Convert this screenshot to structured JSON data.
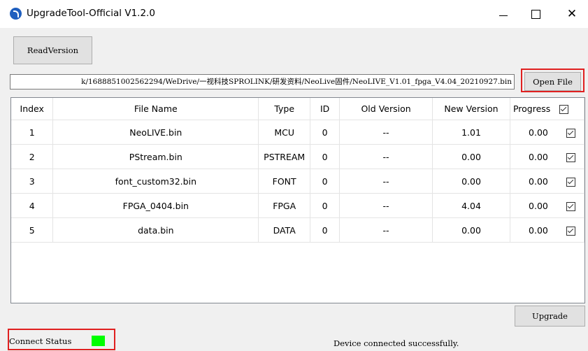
{
  "window": {
    "title": "UpgradeTool-Official V1.2.0",
    "minimize_glyph": "—",
    "maximize_glyph": "☐",
    "close_glyph": "✕"
  },
  "toolbar": {
    "read_version_label": "ReadVersion",
    "open_file_label": "Open File",
    "upgrade_label": "Upgrade"
  },
  "file_path": {
    "value": "k/1688851002562294/WeDrive/一视科技SPROLINK/研发资料/NeoLive固件/NeoLIVE_V1.01_fpga_V4.04_20210927.bin"
  },
  "table": {
    "headers": [
      "Index",
      "File Name",
      "Type",
      "ID",
      "Old Version",
      "New Version",
      "Progress"
    ],
    "rows": [
      {
        "index": "1",
        "file_name": "NeoLIVE.bin",
        "type": "MCU",
        "id": "0",
        "old_version": "--",
        "new_version": "1.01",
        "progress": "0.00",
        "checked": true
      },
      {
        "index": "2",
        "file_name": "PStream.bin",
        "type": "PSTREAM",
        "id": "0",
        "old_version": "--",
        "new_version": "0.00",
        "progress": "0.00",
        "checked": true
      },
      {
        "index": "3",
        "file_name": "font_custom32.bin",
        "type": "FONT",
        "id": "0",
        "old_version": "--",
        "new_version": "0.00",
        "progress": "0.00",
        "checked": true
      },
      {
        "index": "4",
        "file_name": "FPGA_0404.bin",
        "type": "FPGA",
        "id": "0",
        "old_version": "--",
        "new_version": "4.04",
        "progress": "0.00",
        "checked": true
      },
      {
        "index": "5",
        "file_name": "data.bin",
        "type": "DATA",
        "id": "0",
        "old_version": "--",
        "new_version": "0.00",
        "progress": "0.00",
        "checked": true
      }
    ]
  },
  "status": {
    "connect_label": "Connect Status",
    "connect_color": "#00ff00",
    "message": "Device connected successfully."
  },
  "colors": {
    "highlight_box": "#e02020",
    "app_icon": "#1f5fbf"
  }
}
